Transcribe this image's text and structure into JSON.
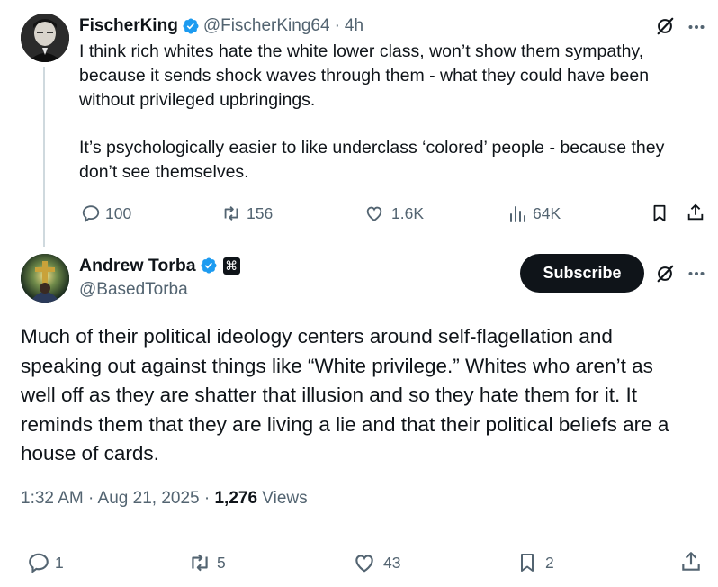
{
  "parent_tweet": {
    "display_name": "FischerKing",
    "handle": "@FischerKing64",
    "separator": "·",
    "time": "4h",
    "lines": [
      "I think rich whites hate the white lower class, won’t show them sympathy,",
      "because it sends shock waves through them - what they could have been",
      "without privileged upbringings.",
      "It’s psychologically easier to like underclass ‘colored’ people - because they",
      "don’t see themselves."
    ],
    "actions": {
      "replies": "100",
      "reposts": "156",
      "likes": "1.6K",
      "views": "64K"
    }
  },
  "main_tweet": {
    "display_name": "Andrew Torba",
    "handle": "@BasedTorba",
    "badge_glyph": "⌘",
    "subscribe_label": "Subscribe",
    "lines": [
      "Much of their political ideology centers around self-flagellation and",
      "speaking out against things like “White privilege.” Whites who aren’t as",
      "well off as they are shatter that illusion and so they hate them for it. It",
      "reminds them that they are living a lie and that their political beliefs are a",
      "house of cards."
    ],
    "time": "1:32 AM · Aug 21, 2025 · ",
    "views_count": "1,276",
    "views_label": " Views",
    "actions": {
      "replies": "1",
      "reposts": "5",
      "likes": "43",
      "bookmarks": "2"
    }
  },
  "colors": {
    "text": "#0f1419",
    "secondary": "#536471",
    "verified": "#1d9bf0",
    "thread_line": "#cfd9de"
  }
}
